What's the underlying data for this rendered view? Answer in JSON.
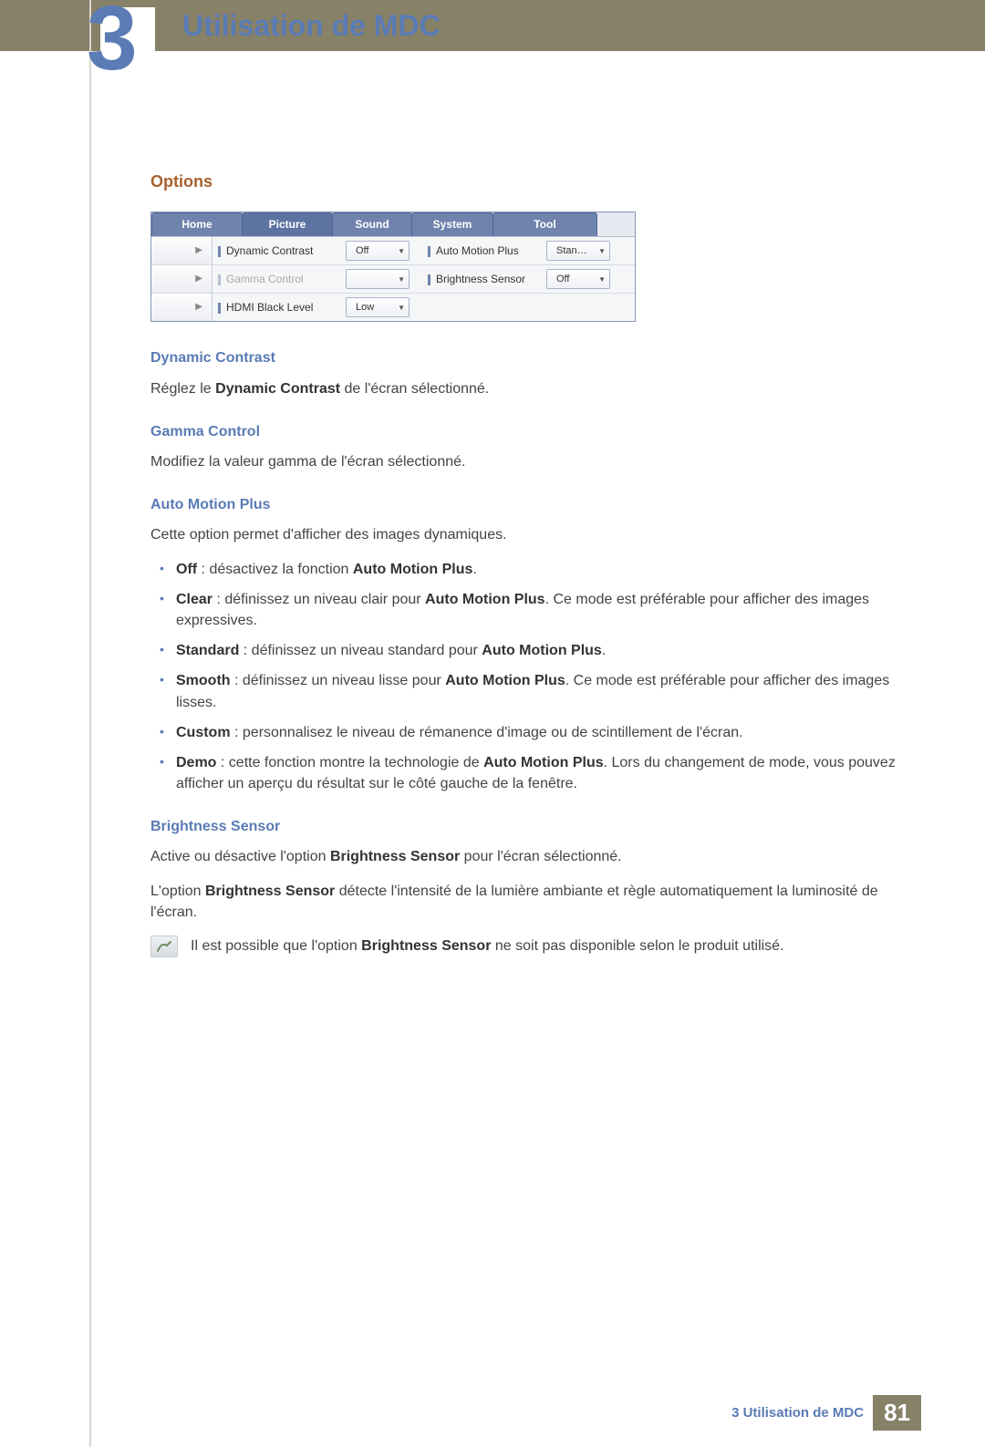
{
  "chapter_number": "3",
  "chapter_title": "Utilisation de MDC",
  "section_title": "Options",
  "panel": {
    "tabs": [
      "Home",
      "Picture",
      "Sound",
      "System",
      "Tool"
    ],
    "rows": [
      {
        "label_l": "Dynamic Contrast",
        "value_l": "Off",
        "disabled_l": false,
        "label_r": "Auto Motion Plus",
        "value_r": "Stan…"
      },
      {
        "label_l": "Gamma Control",
        "value_l": "",
        "disabled_l": true,
        "label_r": "Brightness Sensor",
        "value_r": "Off"
      },
      {
        "label_l": "HDMI Black Level",
        "value_l": "Low",
        "disabled_l": false,
        "label_r": "",
        "value_r": ""
      }
    ]
  },
  "s1": {
    "h": "Dynamic Contrast",
    "p_pre": "Réglez le ",
    "p_b": "Dynamic Contrast",
    "p_post": " de l'écran sélectionné."
  },
  "s2": {
    "h": "Gamma Control",
    "p": "Modifiez la valeur gamma de l'écran sélectionné."
  },
  "s3": {
    "h": "Auto Motion Plus",
    "p": "Cette option permet d'afficher des images dynamiques.",
    "items": [
      {
        "b": "Off",
        "t": " : désactivez la fonction ",
        "b2": "Auto Motion Plus",
        "t2": "."
      },
      {
        "b": "Clear",
        "t": " : définissez un niveau clair pour ",
        "b2": "Auto Motion Plus",
        "t2": ". Ce mode est préférable pour afficher des images expressives."
      },
      {
        "b": "Standard",
        "t": " : définissez un niveau standard pour ",
        "b2": "Auto Motion Plus",
        "t2": "."
      },
      {
        "b": "Smooth",
        "t": " : définissez un niveau lisse pour ",
        "b2": "Auto Motion Plus",
        "t2": ". Ce mode est préférable pour afficher des images lisses."
      },
      {
        "b": "Custom",
        "t": " : personnalisez le niveau de rémanence d'image ou de scintillement de l'écran.",
        "b2": "",
        "t2": ""
      },
      {
        "b": "Demo",
        "t": " : cette fonction montre la technologie de ",
        "b2": "Auto Motion Plus",
        "t2": ". Lors du changement de mode, vous pouvez afficher un aperçu du résultat sur le côté gauche de la fenêtre."
      }
    ]
  },
  "s4": {
    "h": "Brightness Sensor",
    "p1_pre": "Active ou désactive l'option ",
    "p1_b": "Brightness Sensor",
    "p1_post": " pour l'écran sélectionné.",
    "p2_pre": "L'option ",
    "p2_b": "Brightness Sensor",
    "p2_post": " détecte l'intensité de la lumière ambiante et règle automatiquement la luminosité de l'écran.",
    "note_pre": "Il est possible que l'option ",
    "note_b": "Brightness Sensor",
    "note_post": " ne soit pas disponible selon le produit utilisé."
  },
  "footer": {
    "label": "3 Utilisation de MDC",
    "page": "81"
  }
}
